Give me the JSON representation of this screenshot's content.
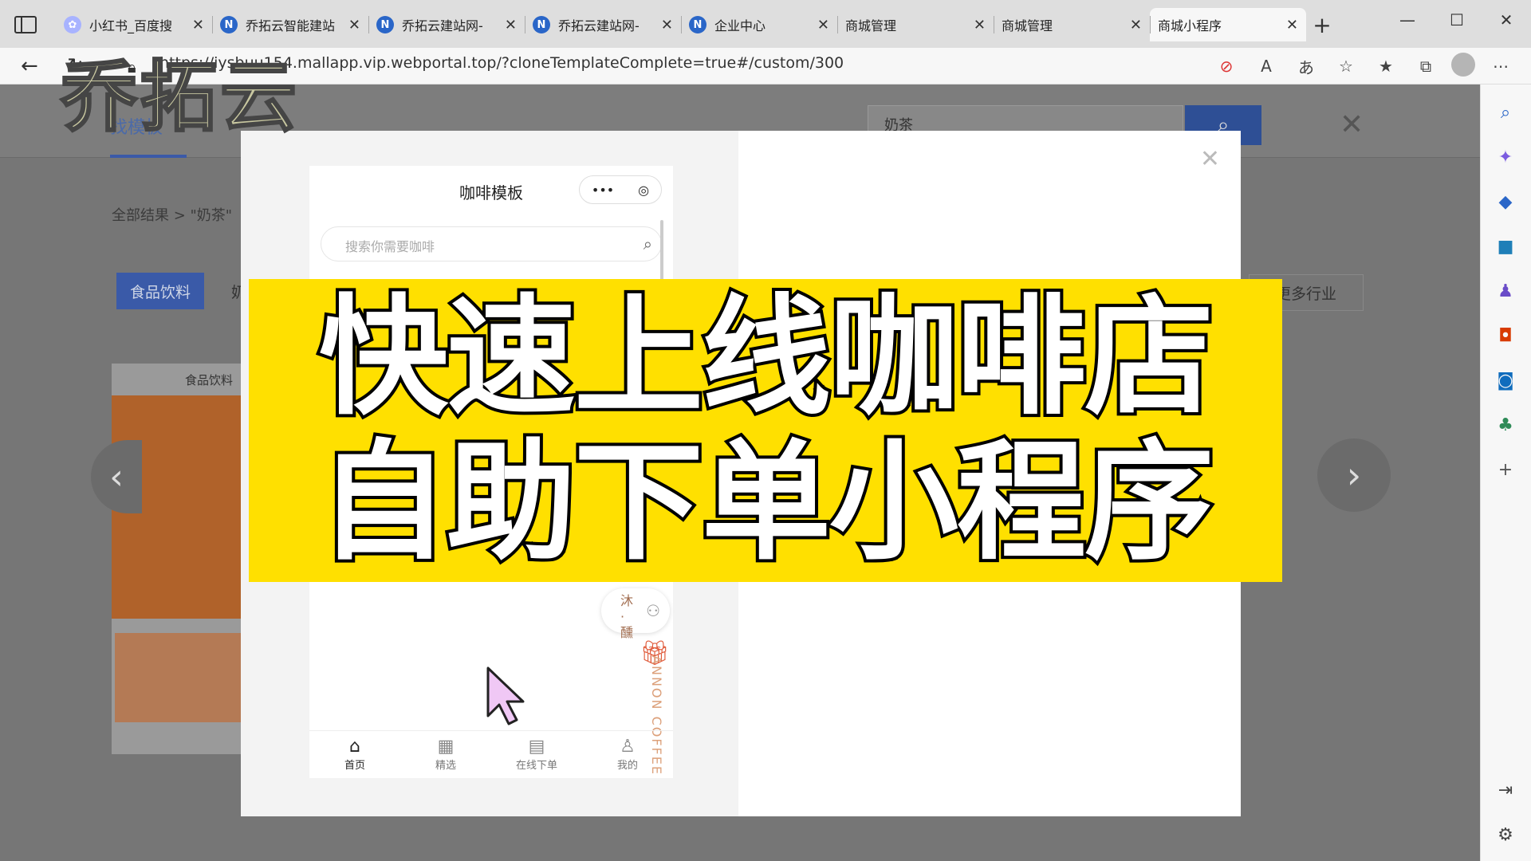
{
  "browser": {
    "tabs": [
      {
        "label": "小红书_百度搜",
        "icon": "paw-icon",
        "glyph": "✿"
      },
      {
        "label": "乔拓云智能建站",
        "icon": "n-logo-icon",
        "glyph": "N"
      },
      {
        "label": "乔拓云建站网-",
        "icon": "n-logo-icon",
        "glyph": "N"
      },
      {
        "label": "乔拓云建站网-",
        "icon": "n-logo-icon",
        "glyph": "N"
      },
      {
        "label": "企业中心",
        "icon": "n-logo-icon",
        "glyph": "N"
      },
      {
        "label": "商城管理",
        "icon": "page-icon",
        "glyph": ""
      },
      {
        "label": "商城管理",
        "icon": "page-icon",
        "glyph": ""
      },
      {
        "label": "商城小程序",
        "icon": "page-icon",
        "glyph": ""
      }
    ],
    "active_tab_index": 7,
    "url": "https://iysbuu154.mallapp.vip.webportal.top/?cloneTemplateComplete=true#/custom/300"
  },
  "page": {
    "active_tab": "找模板",
    "search_value": "奶茶",
    "breadcrumb": "全部结果 > \"奶茶\"",
    "category_active": "食品饮料",
    "category_next": "奶",
    "more_button": "更多行业",
    "card_label": "食品饮料"
  },
  "modal": {
    "phone_title": "咖啡模板",
    "capsule_more": "•••",
    "capsule_target": "◎",
    "search_placeholder": "搜索你需要咖啡",
    "float_text": "沐 · 醺",
    "vertical_text": "ANNON COFFEE",
    "bottom_nav": [
      {
        "label": "首页",
        "icon": "home-icon",
        "glyph": "⌂"
      },
      {
        "label": "精选",
        "icon": "grid-icon",
        "glyph": "▦"
      },
      {
        "label": "在线下单",
        "icon": "clipboard-icon",
        "glyph": "▤"
      },
      {
        "label": "我的",
        "icon": "user-icon",
        "glyph": "♙"
      }
    ]
  },
  "overlay": {
    "watermark": "乔拓云",
    "banner_line1": "快速上线咖啡店",
    "banner_line2": "自助下单小程序",
    "banner_color": "#ffe000"
  }
}
